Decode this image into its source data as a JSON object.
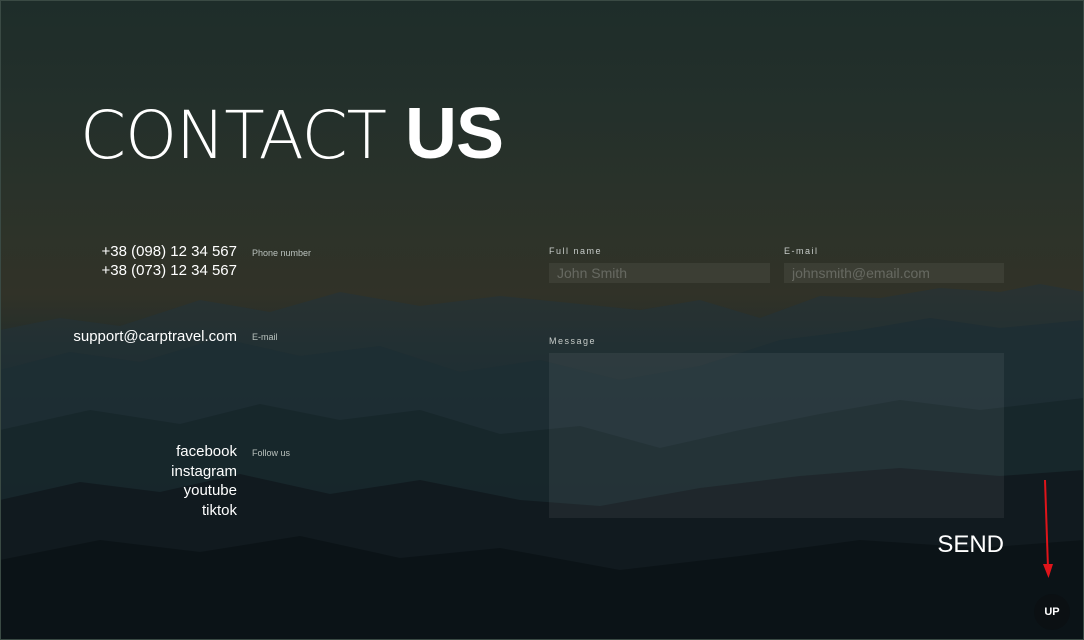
{
  "heading": {
    "light": "CONTACT",
    "bold": "US"
  },
  "contact": {
    "phones": [
      "+38 (098) 12 34 567",
      "+38 (073) 12 34 567"
    ],
    "phone_label": "Phone number",
    "email": "support@carptravel.com",
    "email_label": "E-mail",
    "social": [
      "facebook",
      "instagram",
      "youtube",
      "tiktok"
    ],
    "social_label": "Follow us"
  },
  "form": {
    "full_name_label": "Full name",
    "full_name_placeholder": "John Smith",
    "email_label": "E-mail",
    "email_placeholder": "johnsmith@email.com",
    "message_label": "Message",
    "send_label": "SEND"
  },
  "up_label": "UP",
  "colors": {
    "text": "#ffffff",
    "annotation_arrow": "#e0141a",
    "up_button_bg": "#0b1013"
  }
}
